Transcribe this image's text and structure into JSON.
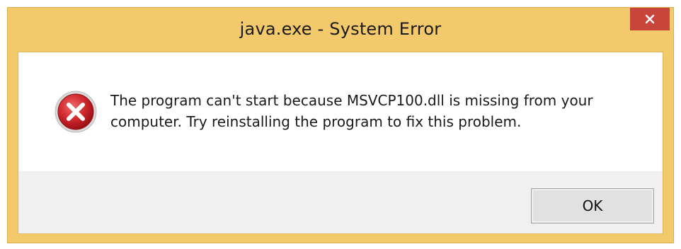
{
  "window": {
    "title": "java.exe - System Error",
    "close_icon": "close-icon"
  },
  "dialog": {
    "icon": "error-icon",
    "message_line1": "The program can't start because MSVCP100.dll is missing from your",
    "message_line2": "computer. Try reinstalling the program to fix this problem.",
    "ok_label": "OK"
  },
  "colors": {
    "frame": "#f2c96b",
    "close_button": "#c7453b",
    "content_bg": "#ffffff",
    "footer_bg": "#f0f0f0",
    "error_red": "#c8202a"
  }
}
